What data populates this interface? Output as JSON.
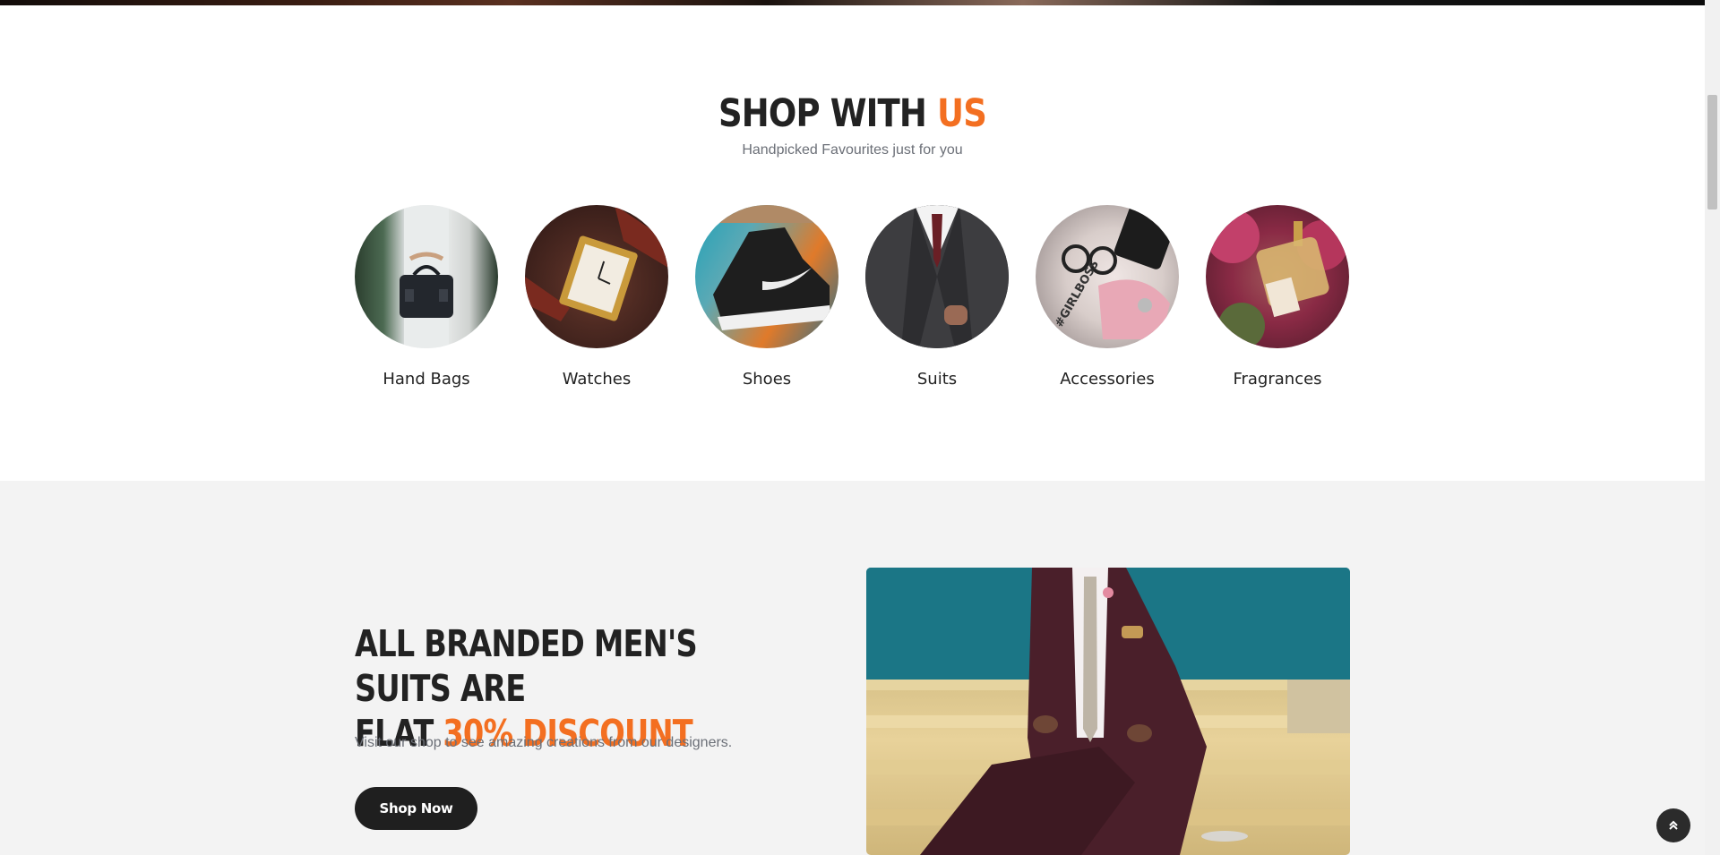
{
  "shop_section": {
    "title_main": "SHOP WITH",
    "title_accent": "US",
    "subtitle": "Handpicked Favourites just for you",
    "categories": [
      {
        "label": "Hand Bags",
        "icon": "handbag-image"
      },
      {
        "label": "Watches",
        "icon": "watch-image"
      },
      {
        "label": "Shoes",
        "icon": "shoe-image"
      },
      {
        "label": "Suits",
        "icon": "suit-image"
      },
      {
        "label": "Accessories",
        "icon": "accessories-image"
      },
      {
        "label": "Fragrances",
        "icon": "perfume-image"
      }
    ]
  },
  "promo": {
    "heading_line1": "ALL BRANDED MEN'S SUITS ARE",
    "heading_line2_prefix": "FLAT ",
    "heading_accent": "30% DISCOUNT",
    "text": "Visit our shop to see amazing creations from our designers.",
    "button_label": "Shop Now"
  },
  "colors": {
    "accent": "#f36f21",
    "heading": "#222222",
    "muted_text": "#6b6f77",
    "button_bg": "#1f1f1f",
    "promo_bg": "#f3f3f3"
  },
  "icons": {
    "back_to_top": "double-chevron-up-icon"
  }
}
